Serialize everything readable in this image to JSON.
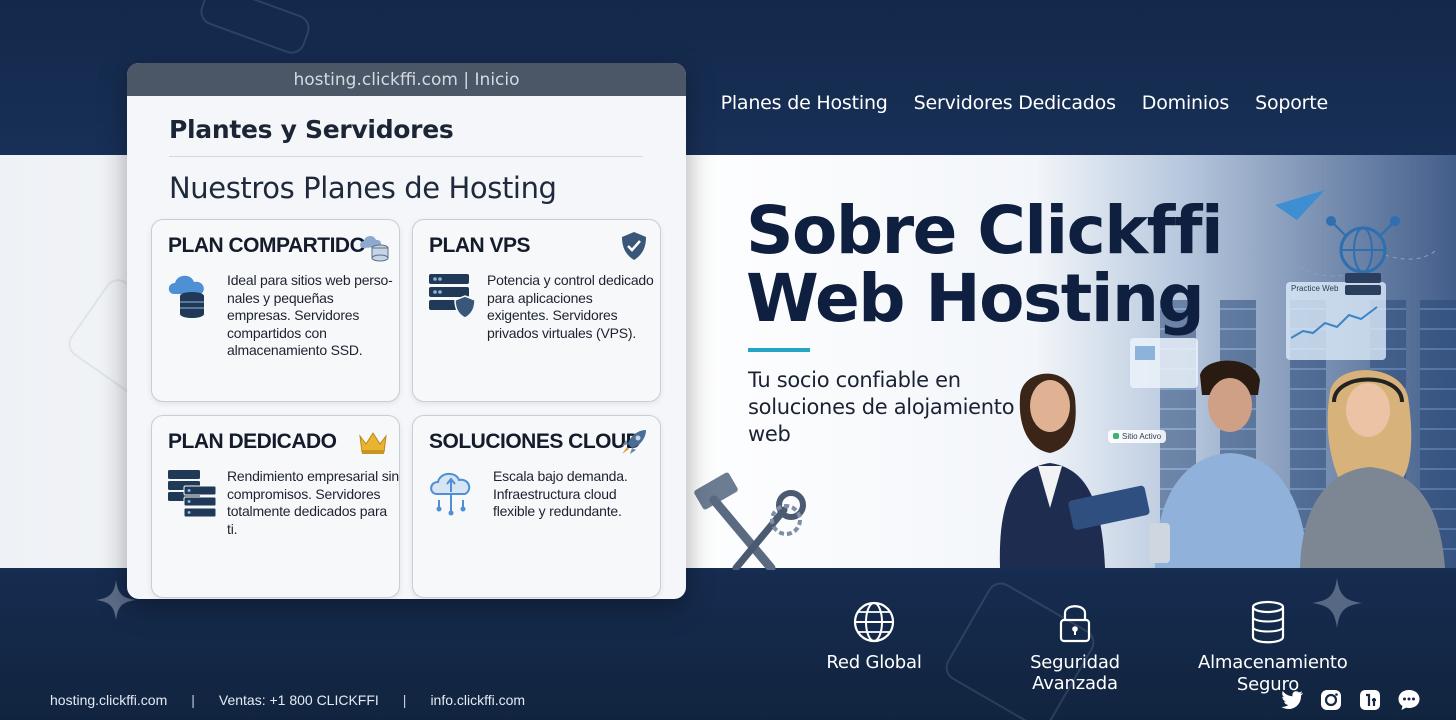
{
  "browser": {
    "address": "hosting.clickffi.com | Inicio"
  },
  "nav": {
    "items": [
      {
        "label": "Planes de Hosting"
      },
      {
        "label": "Servidores Dedicados"
      },
      {
        "label": "Dominios"
      },
      {
        "label": "Soporte"
      }
    ]
  },
  "card": {
    "heading": "Plantes y Servidores",
    "subheading": "Nuestros Planes de Hosting",
    "plans": [
      {
        "title": "PLAN COMPARTIDO",
        "description": "Ideal para sitios web perso-nales y pequeñas empresas. Servidores compartidos con almacenamiento SSD.",
        "icon": "cloud-database-icon"
      },
      {
        "title": "PLAN VPS",
        "description": "Potencia y control dedicado para aplicaciones exigentes. Servidores privados virtuales (VPS).",
        "icon": "shield-check-icon"
      },
      {
        "title": "PLAN DEDICADO",
        "description": "Rendimiento empresarial sin compromisos. Servidores totalmente dedicados para ti.",
        "icon": "crown-icon"
      },
      {
        "title": "SOLUCIONES CLOUD",
        "description": "Escala bajo demanda. Infraestructura cloud flexible y redundante.",
        "icon": "rocket-icon"
      }
    ]
  },
  "hero": {
    "title": "Sobre Clickffi Web Hosting",
    "subtitle": "Tu socio confiable en soluciones de alojamiento web"
  },
  "floaters": {
    "status_label": "Sitio Activo",
    "dashboard_label": "Practice Web"
  },
  "features": [
    {
      "label": "Red Global",
      "icon": "globe-icon"
    },
    {
      "label": "Seguridad Avanzada",
      "icon": "padlock-icon"
    },
    {
      "label": "Almacenamiento Seguro",
      "icon": "database-icon"
    }
  ],
  "footer": {
    "site": "hosting.clickffi.com",
    "sales": "Ventas: +1 800 CLICKFFI",
    "email": "info.clickffi.com"
  },
  "socials": [
    "twitter-icon",
    "instagram-icon",
    "app-icon",
    "chat-icon"
  ],
  "colors": {
    "navy": "#13284a",
    "accent": "#26a4c4",
    "card_bg": "#f4f6f9",
    "crown": "#e8b431"
  }
}
